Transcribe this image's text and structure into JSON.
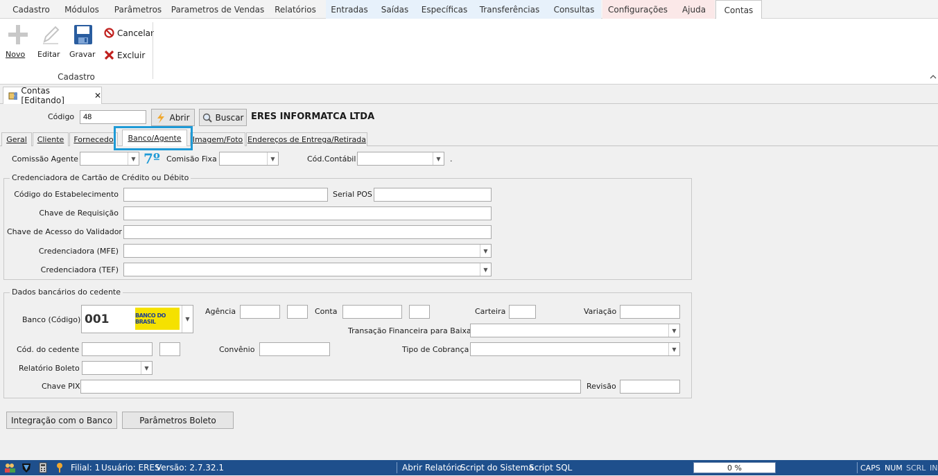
{
  "menu": {
    "items": [
      "Cadastro",
      "Módulos",
      "Parâmetros",
      "Parametros de Vendas",
      "Relatórios",
      "Entradas",
      "Saídas",
      "Específicas",
      "Transferências",
      "Consultas",
      "Configurações",
      "Ajuda",
      "Contas"
    ],
    "active": "Contas"
  },
  "ribbon": {
    "novo": "Novo",
    "editar": "Editar",
    "gravar": "Gravar",
    "cancelar": "Cancelar",
    "excluir": "Excluir",
    "group_label": "Cadastro"
  },
  "doc_tab": {
    "title": "Contas [Editando]",
    "close": "✕"
  },
  "header": {
    "codigo_label": "Código",
    "codigo_value": "48",
    "abrir": "Abrir",
    "buscar": "Buscar",
    "company": "ERES INFORMATCA LTDA"
  },
  "tabs": [
    "Geral",
    "Cliente",
    "Fornecedo",
    "Banco/Agente",
    "Imagem/Foto",
    "Endereços de Entrega/Retirada"
  ],
  "active_tab": "Banco/Agente",
  "annotation": "7º",
  "agent": {
    "comissao_agente": "Comissão Agente",
    "comisao_fixa": "Comisão Fixa",
    "cod_contabil": "Cód.Contábil",
    "dot": "."
  },
  "cred_group": {
    "title": "Credenciadora de Cartão de Crédito ou Débito",
    "cod_estab": "Código do Estabelecimento",
    "serial_pos": "Serial POS",
    "chave_req": "Chave de Requisição",
    "chave_acesso": "Chave de Acesso do Validador",
    "cred_mfe": "Credenciadora (MFE)",
    "cred_tef": "Credenciadora (TEF)"
  },
  "bank_group": {
    "title": "Dados bancários do cedente",
    "banco_label": "Banco (Código)",
    "banco_code": "001",
    "banco_logo": "BANCO DO BRASIL",
    "agencia": "Agência",
    "conta": "Conta",
    "carteira": "Carteira",
    "variacao": "Variação",
    "transacao": "Transação Financeira para Baixas",
    "cod_cedente": "Cód. do cedente",
    "convenio": "Convênio",
    "tipo_cobranca": "Tipo de Cobrança",
    "relatorio_boleto": "Relatório Boleto",
    "chave_pix": "Chave PIX",
    "revisao": "Revisão"
  },
  "bottom_buttons": {
    "integracao": "Integração com o Banco",
    "parametros": "Parâmetros Boleto"
  },
  "status": {
    "filial": "Filial: 1",
    "usuario": "Usuário: ERES",
    "versao": "Versão: 2.7.32.1",
    "abrir_relatorio": "Abrir Relatório",
    "script_sistema": "Script do Sistema",
    "script_sql": "Script SQL",
    "progress": "0 %",
    "caps": "CAPS",
    "num": "NUM",
    "scrl": "SCRL",
    "ins": "INS"
  },
  "colors": {
    "accent": "#1e9ad6",
    "statusbar": "#1e4f8c"
  }
}
